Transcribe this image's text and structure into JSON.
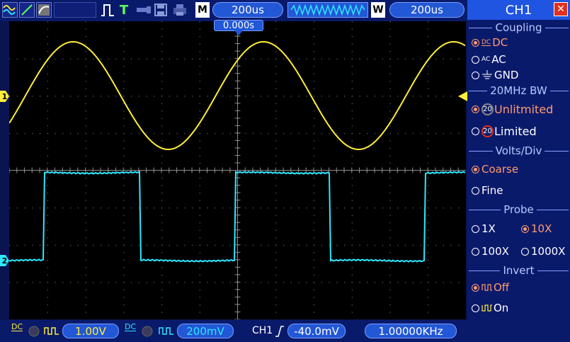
{
  "toolbar": {
    "timebase": "200us",
    "window_timebase": "200us",
    "m_label": "M",
    "w_label": "W",
    "trigger_mode": "T",
    "position": "0.000s"
  },
  "channels": {
    "ch1_marker": "1",
    "ch2_marker": "2"
  },
  "bottombar": {
    "ch1_volts": "1.00V",
    "ch2_volts": "200mV",
    "trigger_source": "CH1",
    "trigger_level": "-40.0mV",
    "frequency": "1.00000KHz",
    "coupling_ch1": "DC",
    "coupling_ch2": "DC"
  },
  "menu": {
    "title": "CH1",
    "close": "✕",
    "coupling": {
      "label": "Coupling",
      "options": [
        "DC",
        "AC",
        "GND"
      ],
      "dc_sym": "DC",
      "ac_sym": "AC"
    },
    "bw": {
      "label": "20MHz BW",
      "options": [
        "Unlitmited",
        "Limited"
      ],
      "badge": "20"
    },
    "volts": {
      "label": "Volts/Div",
      "options": [
        "Coarse",
        "Fine"
      ]
    },
    "probe": {
      "label": "Probe",
      "options": [
        "1X",
        "10X",
        "100X",
        "1000X"
      ]
    },
    "invert": {
      "label": "Invert",
      "options": [
        "Off",
        "On"
      ]
    }
  },
  "colors": {
    "ch1": "#ffee3a",
    "ch2": "#2ee8ff",
    "accent": "#2257d6",
    "selected": "#ff9a70"
  }
}
